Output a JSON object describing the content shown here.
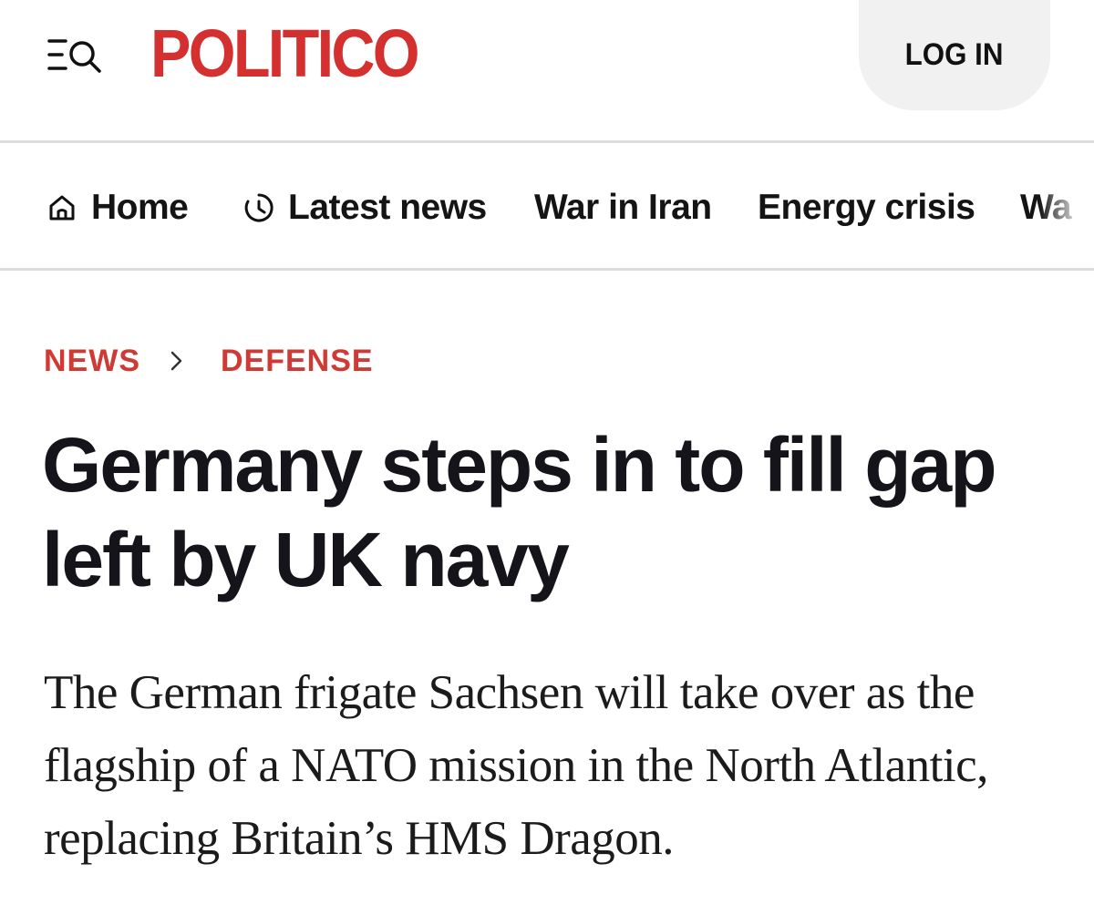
{
  "header": {
    "logo_text": "POLITICO",
    "login_label": "LOG IN",
    "brand_color": "#d3302f",
    "menu_icon": "menu-search-icon"
  },
  "nav": {
    "items": [
      {
        "label": "Home",
        "icon": "home-icon"
      },
      {
        "label": "Latest news",
        "icon": "clock-icon"
      },
      {
        "label": "War in Iran"
      },
      {
        "label": "Energy crisis"
      },
      {
        "label": "Wa"
      }
    ]
  },
  "breadcrumb": {
    "items": [
      "NEWS",
      "DEFENSE"
    ],
    "separator_icon": "chevron-right-icon",
    "color": "#cf3a35"
  },
  "article": {
    "headline": "Germany steps in to fill gap left by UK navy",
    "dek": "The German frigate Sachsen will take over as the flagship of a NATO mission in the North Atlantic, replacing Britain’s HMS Dragon."
  }
}
